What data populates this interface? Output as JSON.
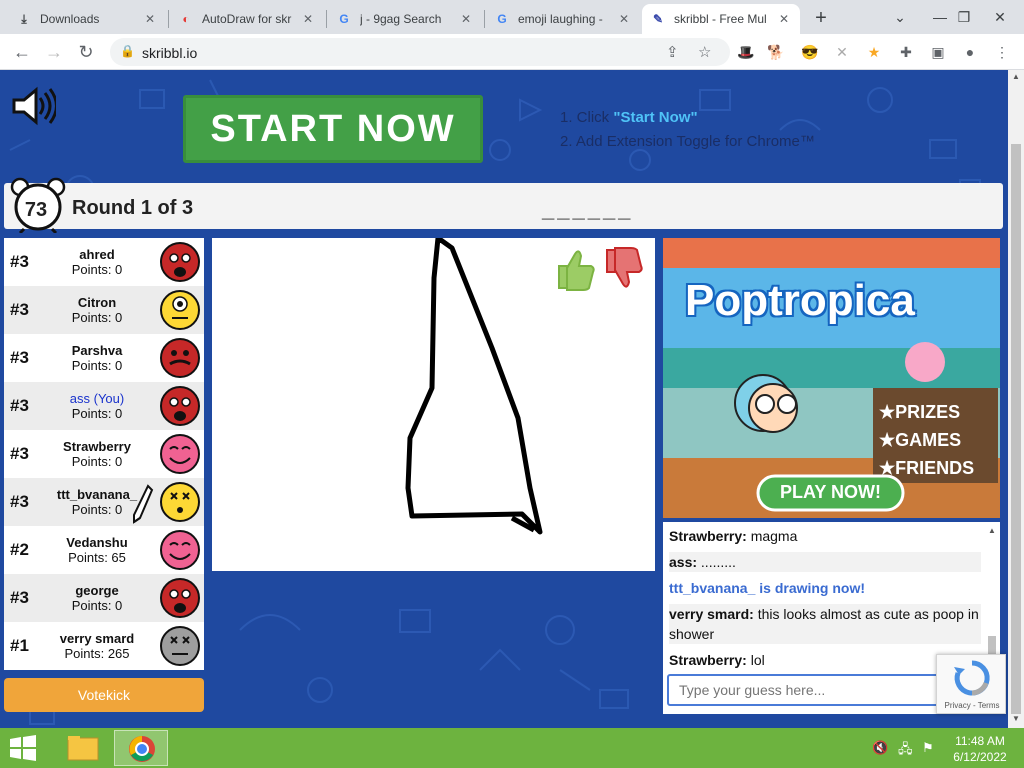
{
  "browser": {
    "tabs": [
      {
        "label": "Downloads",
        "icon": "download-icon",
        "active": false
      },
      {
        "label": "AutoDraw for skr",
        "icon": "autodraw-icon",
        "active": false
      },
      {
        "label": "j - 9gag Search",
        "icon": "google-icon",
        "active": false
      },
      {
        "label": "emoji laughing - ",
        "icon": "google-icon",
        "active": false
      },
      {
        "label": "skribbl - Free Mul",
        "icon": "skribbl-icon",
        "active": true
      }
    ],
    "url": "skribbl.io"
  },
  "header": {
    "start_button": "START NOW",
    "step1_prefix": "1. Click ",
    "step1_link": "\"Start Now\"",
    "step2": "2. Add Extension Toggle for Chrome™"
  },
  "game": {
    "timer": "73",
    "round": "Round 1 of 3",
    "word_hint": "______"
  },
  "players": [
    {
      "rank": "#3",
      "name": "ahred",
      "points": "Points: 0",
      "color": "#c62828",
      "face": "shout",
      "you": false,
      "drawing": false
    },
    {
      "rank": "#3",
      "name": "Citron",
      "points": "Points: 0",
      "color": "#fdd835",
      "face": "cyclops",
      "you": false,
      "drawing": false
    },
    {
      "rank": "#3",
      "name": "Parshva",
      "points": "Points: 0",
      "color": "#c62828",
      "face": "mustache",
      "you": false,
      "drawing": false
    },
    {
      "rank": "#3",
      "name": "ass (You)",
      "points": "Points: 0",
      "color": "#c62828",
      "face": "shout",
      "you": true,
      "drawing": false
    },
    {
      "rank": "#3",
      "name": "Strawberry",
      "points": "Points: 0",
      "color": "#f06292",
      "face": "smile",
      "you": false,
      "drawing": false
    },
    {
      "rank": "#3",
      "name": "ttt_bvanana_",
      "points": "Points: 0",
      "color": "#fdd835",
      "face": "dizzy",
      "you": false,
      "drawing": true
    },
    {
      "rank": "#2",
      "name": "Vedanshu",
      "points": "Points: 65",
      "color": "#f06292",
      "face": "smile",
      "you": false,
      "drawing": false
    },
    {
      "rank": "#3",
      "name": "george",
      "points": "Points: 0",
      "color": "#c62828",
      "face": "shout",
      "you": false,
      "drawing": false
    },
    {
      "rank": "#1",
      "name": "verry smard",
      "points": "Points: 265",
      "color": "#9e9e9e",
      "face": "dead",
      "you": false,
      "drawing": false
    }
  ],
  "votekick_label": "Votekick",
  "ad": {
    "brand": "Poptropica",
    "line1": "★PRIZES",
    "line2": "★GAMES",
    "line3": "★FRIENDS",
    "cta": "PLAY NOW!"
  },
  "chat": {
    "messages": [
      {
        "author": "Strawberry:",
        "text": " magma"
      },
      {
        "author": "ass:",
        "text": " ........."
      },
      {
        "author": "",
        "text": "ttt_bvanana_ is drawing now!"
      },
      {
        "author": "verry smard:",
        "text": " this looks almost as cute as poop in shower"
      },
      {
        "author": "Strawberry:",
        "text": " lol"
      }
    ],
    "placeholder": "Type your guess here...",
    "recaptcha_label": "Privacy - Terms"
  },
  "taskbar": {
    "time": "11:48 AM",
    "date": "6/12/2022"
  }
}
